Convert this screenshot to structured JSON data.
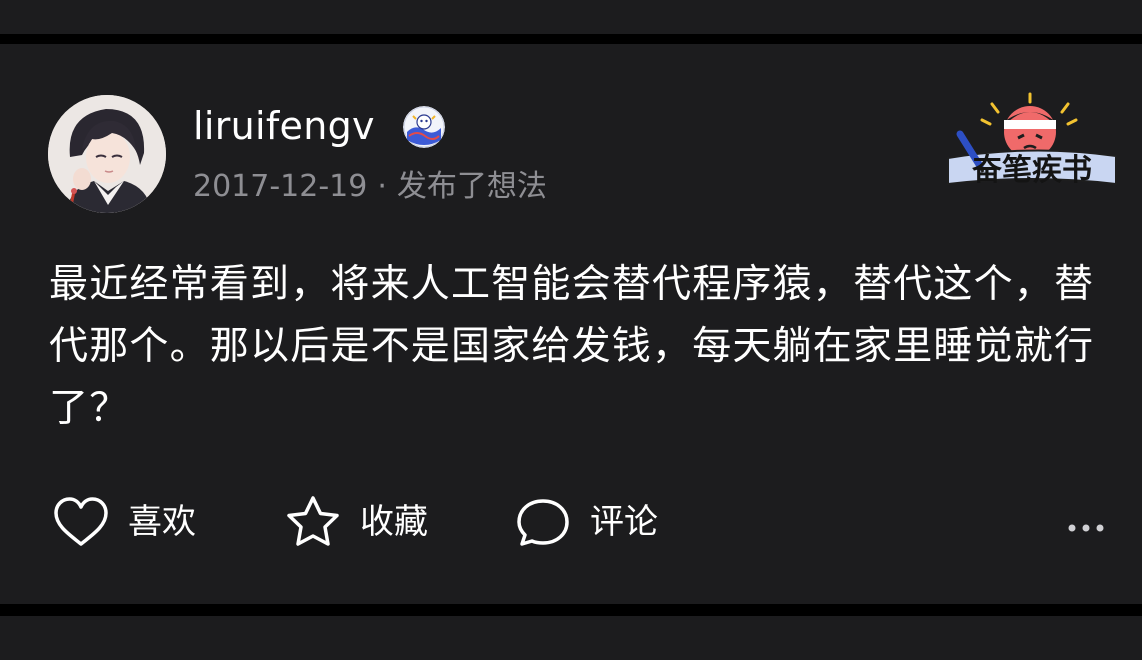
{
  "post": {
    "author": {
      "username": "liruifengv",
      "avatar_icon": "avatar",
      "verified_badge_icon": "cartoon-badge-icon"
    },
    "date": "2017-12-19",
    "separator": "·",
    "action_text": "发布了想法",
    "source_logo_text": "奋笔疾书",
    "text": "最近经常看到，将来人工智能会替代程序猿，替代这个，替代那个。那以后是不是国家给发钱，每天躺在家里睡觉就行了？"
  },
  "actions": {
    "like_label": "喜欢",
    "like_icon": "heart-outline-icon",
    "favorite_label": "收藏",
    "favorite_icon": "star-outline-icon",
    "comment_label": "评论",
    "comment_icon": "comment-bubble-icon",
    "more_icon": "more-dots-icon"
  },
  "colors": {
    "background": "#000000",
    "card": "#1c1c1e",
    "text_primary": "#ffffff",
    "text_secondary": "#8e8e93"
  }
}
